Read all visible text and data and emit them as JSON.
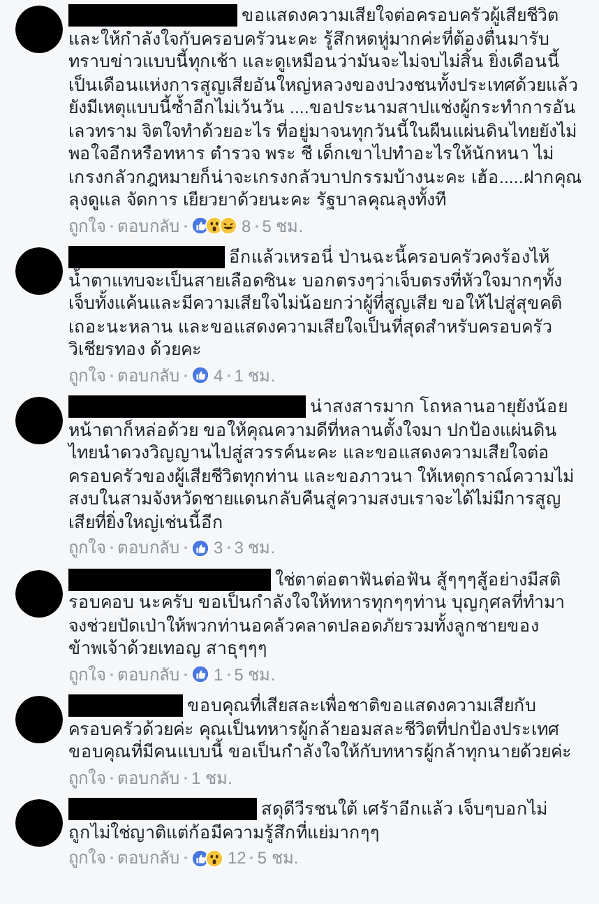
{
  "comments": [
    {
      "first_line": "ขอแสดงความเสียใจต่อครอบครัวผู้เสียชีวิต",
      "text": "และให้กำลังใจกับครอบครัวนะคะ รู้สึกหดหู่มากค่ะที่ต้องตื่นมารับทราบข่าวแบบนี้ทุกเช้า และดูเหมือนว่ามันจะไม่จบไม่สิ้น ยิ่งเดือนนี้เป็นเดือนแห่งการสูญเสียอันใหญ่หลวงของปวงชนทั้งประเทศด้วยแล้ว ยังมีเหตุแบบนี้ซ้ำอีกไม่เว้นวัน ....ขอประนามสาปแช่งผู้กระทำการอันเลวทราม จิตใจทำด้วยอะไร ที่อยู่มาจนทุกวันนี้ในผืนแผ่นดินไทยยังไม่พอใจอีกหรือทหาร ตำรวจ พระ ชี เด็กเขาไปทำอะไรให้นักหนา ไม่เกรงกลัวกฎหมายก็น่าจะเกรงกลัวบาปกรรมบ้างนะคะ เฮ้อ.....ฝากคุณลุงดูแล จัดการ เยียวยาด้วยนะคะ รัฐบาลคุณลุงทั้งที",
      "like": "ถูกใจ",
      "reply": "ตอบกลับ",
      "reactions": [
        {
          "kind": "like"
        },
        {
          "kind": "wow"
        },
        {
          "kind": "haha"
        }
      ],
      "count": "8",
      "time": "5 ชม."
    },
    {
      "first_line": "อีกแล้วเหรอนี่ ป่านฉะนี้ครอบครัวคงร้องไห้",
      "text": "น้ำตาแทบจะเป็นสายเลือดซินะ บอกตรงๆว่าเจ็บตรงที่หัวใจมากๆทั้งเจ็บทั้งแค้นและมีความเสียใจไม่น้อยกว่าผู้ที่สูญเสีย ขอให้ไปสู่สุขคติเถอะนะหลาน และขอแสดงความเสียใจเป็นที่สุดสำหรับครอบครัววิเชียรทอง ด้วยคะ",
      "like": "ถูกใจ",
      "reply": "ตอบกลับ",
      "reactions": [
        {
          "kind": "like"
        }
      ],
      "count": "4",
      "time": "1 ชม."
    },
    {
      "first_line": "น่าสงสารมาก โถหลานอายุยังน้อย",
      "text": "หน้าตาก็หล่อด้วย ขอให้คุณความดีที่หลานตั้งใจมา ปกป้องแผ่นดินไทยนำดวงวิญญานไปสู่สวรรค์นะคะ และขอแสดงความเสียใจต่อครอบครัวของผู้เสียชีวิตทุกท่าน และขอภาวนา ให้เหตุกราณ์ความไม่สงบในสามจังหวัดชายแดนกลับคืนสู่ความสงบเราจะได้ไม่มีการสูญเสียที่ยิ่งใหญ่เช่นนี้อีก",
      "like": "ถูกใจ",
      "reply": "ตอบกลับ",
      "reactions": [
        {
          "kind": "like"
        }
      ],
      "count": "3",
      "time": "3 ชม."
    },
    {
      "first_line": "ใช่ตาต่อตาฟันต่อฟัน สู้ๆๆๆสู้อย่างมีสติ",
      "text": "รอบคอบ นะครับ ขอเป็นกำลังใจให้ทหารทุกๆๆท่าน บุญกุศลที่ทำมาจงช่วยปัดเป่าให้พวกท่านอคล้วคลาดปลอดภัยรวมทั้งลูกชายของข้าพเจ้าด้วยเทอญ สาธุๆๆๆ",
      "like": "ถูกใจ",
      "reply": "ตอบกลับ",
      "reactions": [
        {
          "kind": "like"
        }
      ],
      "count": "1",
      "time": "5 ชม."
    },
    {
      "first_line": "ขอบคุณที่เสียสละเพื่อชาติขอแสดงความเสียกับ",
      "text": "ครอบครัวด้วยค่ะ คุณเป็นทหารผู้กล้ายอมสละชีวิตที่ปกป้องประเทศขอบคุณที่มีคนแบบนี้ ขอเป็นกำลังใจให้กับทหารผู้กล้าทุกนายด้วยค่ะ",
      "like": "ถูกใจ",
      "reply": "ตอบกลับ",
      "time": "1 ชม."
    },
    {
      "first_line": "สดุดีวีรชนใต้ เศร้าอีกแล้ว เจ็บๆบอกไม่",
      "text": "ถูกไม่ใช่ญาติแต่ก้อมีความรู้สึกที่แย่มากๆๆ",
      "like": "ถูกใจ",
      "reply": "ตอบกลับ",
      "reactions": [
        {
          "kind": "like"
        },
        {
          "kind": "wow"
        }
      ],
      "count": "12",
      "time": "5 ชม."
    }
  ]
}
